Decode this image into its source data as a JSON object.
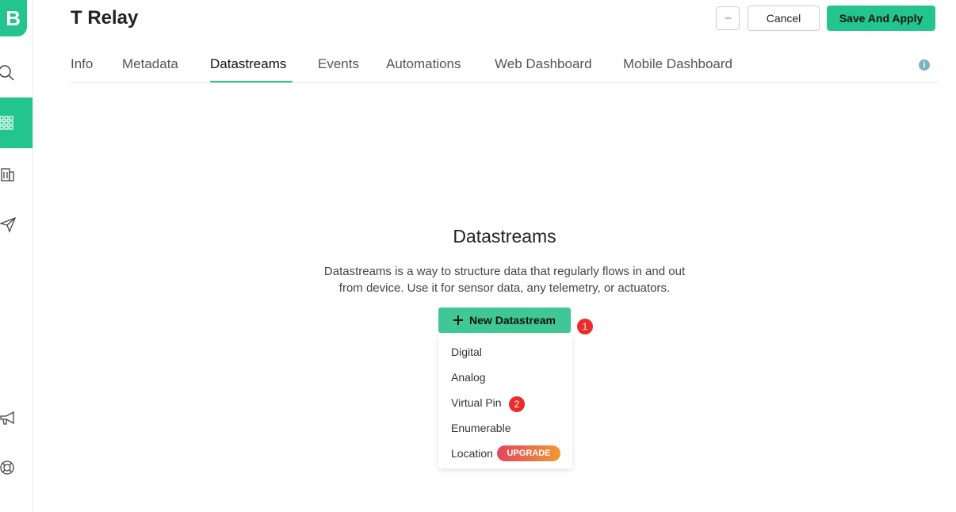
{
  "app": {
    "logo_letter": "B"
  },
  "sidebar": {
    "items": [
      {
        "icon": "search-icon"
      },
      {
        "icon": "grid-icon",
        "active": true
      },
      {
        "icon": "building-icon"
      },
      {
        "icon": "send-icon"
      },
      {
        "icon": "megaphone-icon"
      },
      {
        "icon": "lifebuoy-icon"
      }
    ]
  },
  "header": {
    "title": "T Relay",
    "more_label": "◦◦◦",
    "cancel_label": "Cancel",
    "save_label": "Save And Apply"
  },
  "tabs": [
    {
      "label": "Info"
    },
    {
      "label": "Metadata"
    },
    {
      "label": "Datastreams",
      "active": true
    },
    {
      "label": "Events"
    },
    {
      "label": "Automations"
    },
    {
      "label": "Web Dashboard"
    },
    {
      "label": "Mobile Dashboard"
    }
  ],
  "info_icon": "i",
  "empty_state": {
    "heading": "Datastreams",
    "description_line1": "Datastreams is a way to structure data that regularly flows in and out",
    "description_line2": "from device. Use it for sensor data, any telemetry, or actuators.",
    "new_button_label": "New Datastream",
    "new_button_badge": "1"
  },
  "dropdown": {
    "items": [
      {
        "label": "Digital"
      },
      {
        "label": "Analog"
      },
      {
        "label": "Virtual Pin",
        "badge": "2"
      },
      {
        "label": "Enumerable"
      },
      {
        "label": "Location",
        "tag": "UPGRADE"
      }
    ]
  },
  "colors": {
    "accent": "#23c48e",
    "badge": "#ec2b2b",
    "upgrade_gradient_start": "#e3455f",
    "upgrade_gradient_end": "#ef9a33"
  }
}
